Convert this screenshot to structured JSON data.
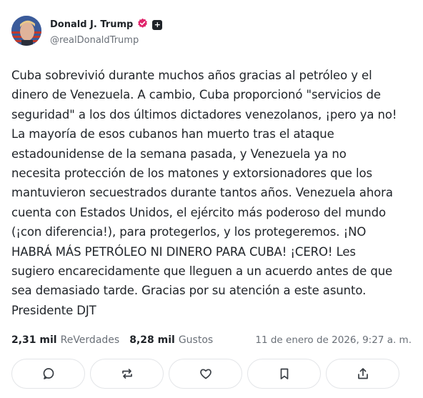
{
  "author": {
    "name": "Donald J. Trump",
    "handle": "@realDonaldTrump",
    "avatar_icon": "avatar-flag-portrait",
    "verified_icon": "verified-badge-icon",
    "verified_color": "#e0246b",
    "plus_icon": "plus-badge-icon"
  },
  "post": {
    "lines": [
      "Cuba sobrevivió durante muchos años gracias al petróleo y el",
      "dinero de Venezuela. A cambio, Cuba proporcionó \"servicios de",
      "seguridad\" a los dos últimos dictadores venezolanos, ¡pero ya no!",
      "La mayoría de esos cubanos han muerto tras el ataque",
      "estadounidense de la semana pasada, y Venezuela ya no",
      "necesita protección de los matones y extorsionadores que los",
      "mantuvieron secuestrados durante tantos años. Venezuela ahora",
      "cuenta con Estados Unidos, el ejército más poderoso del mundo",
      "(¡con diferencia!), para protegerlos, y los protegeremos. ¡NO",
      "HABRÁ MÁS PETRÓLEO NI DINERO PARA CUBA! ¡CERO! Les",
      "sugiero encarecidamente que lleguen a un acuerdo antes de que",
      "sea demasiado tarde. Gracias por su atención a este asunto.",
      "Presidente DJT"
    ]
  },
  "stats": {
    "reposts_count": "2,31 mil",
    "reposts_label": "ReVerdades",
    "likes_count": "8,28 mil",
    "likes_label": "Gustos",
    "timestamp": "11 de enero de 2026, 9:27 a. m."
  },
  "actions": [
    {
      "icon": "reply-icon"
    },
    {
      "icon": "repost-icon"
    },
    {
      "icon": "like-icon"
    },
    {
      "icon": "bookmark-icon"
    },
    {
      "icon": "share-icon"
    }
  ]
}
